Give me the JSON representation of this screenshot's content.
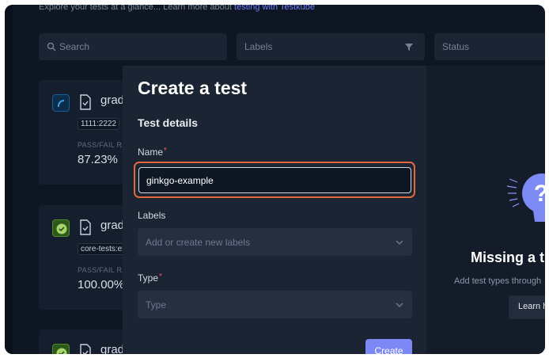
{
  "header": {
    "subtitle_prefix": "Explore your tests at a glance... Learn more about ",
    "subtitle_link": "testing with Testkube"
  },
  "filters": {
    "search_placeholder": "Search",
    "labels_placeholder": "Labels",
    "status_placeholder": "Status"
  },
  "cards": [
    {
      "name": "grad",
      "tag": "1111:2222",
      "passfail_label": "PASS/FAIL RA",
      "rate": "87.23%",
      "status": "running"
    },
    {
      "name": "grad",
      "tag": "core-tests:ex",
      "passfail_label": "PASS/FAIL RA",
      "rate": "100.00%",
      "status": "passed"
    },
    {
      "name": "grad",
      "tag": "",
      "passfail_label": "",
      "rate": "",
      "status": "passed"
    }
  ],
  "modal": {
    "title": "Create a test",
    "section": "Test details",
    "name_label": "Name",
    "required_mark": "*",
    "name_value": "ginkgo-example",
    "labels_label": "Labels",
    "labels_placeholder": "Add or create new labels",
    "type_label": "Type",
    "type_placeholder": "Type",
    "create_button": "Create",
    "side": {
      "heading": "Missing a t",
      "text": "Add test types through",
      "button": "Learn h"
    }
  },
  "colors": {
    "accent": "#7c88f6",
    "focus_ring": "#e2673c",
    "required": "#ef5b5b",
    "background": "#0e1623"
  }
}
